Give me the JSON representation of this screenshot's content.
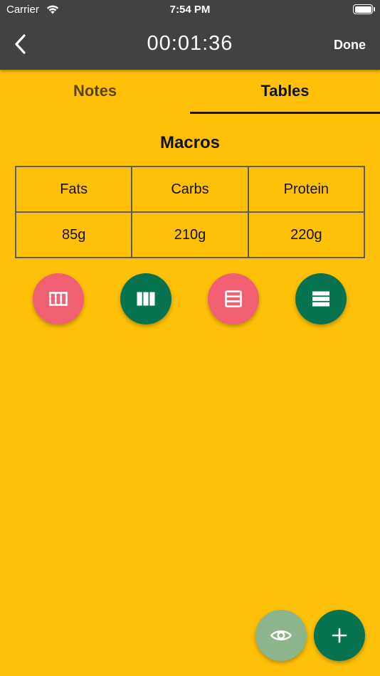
{
  "status_bar": {
    "carrier": "Carrier",
    "time": "7:54 PM"
  },
  "header": {
    "timer": "00:01:36",
    "done_label": "Done"
  },
  "tabs": [
    {
      "label": "Notes",
      "active": false
    },
    {
      "label": "Tables",
      "active": true
    }
  ],
  "table": {
    "title": "Macros",
    "headers": [
      "Fats",
      "Carbs",
      "Protein"
    ],
    "rows": [
      [
        "85g",
        "210g",
        "220g"
      ]
    ]
  },
  "actions": [
    {
      "name": "add-column-icon",
      "color": "#F06072"
    },
    {
      "name": "remove-column-icon",
      "color": "#087350"
    },
    {
      "name": "add-row-icon",
      "color": "#F06072"
    },
    {
      "name": "remove-row-icon",
      "color": "#087350"
    }
  ],
  "fabs": [
    {
      "name": "eye-icon",
      "color": "#8DB58D"
    },
    {
      "name": "plus-icon",
      "color": "#087350"
    }
  ],
  "colors": {
    "background": "#FFC107",
    "toolbar": "#424242",
    "accent_pink": "#F06072",
    "accent_green": "#087350",
    "accent_sage": "#8DB58D"
  }
}
